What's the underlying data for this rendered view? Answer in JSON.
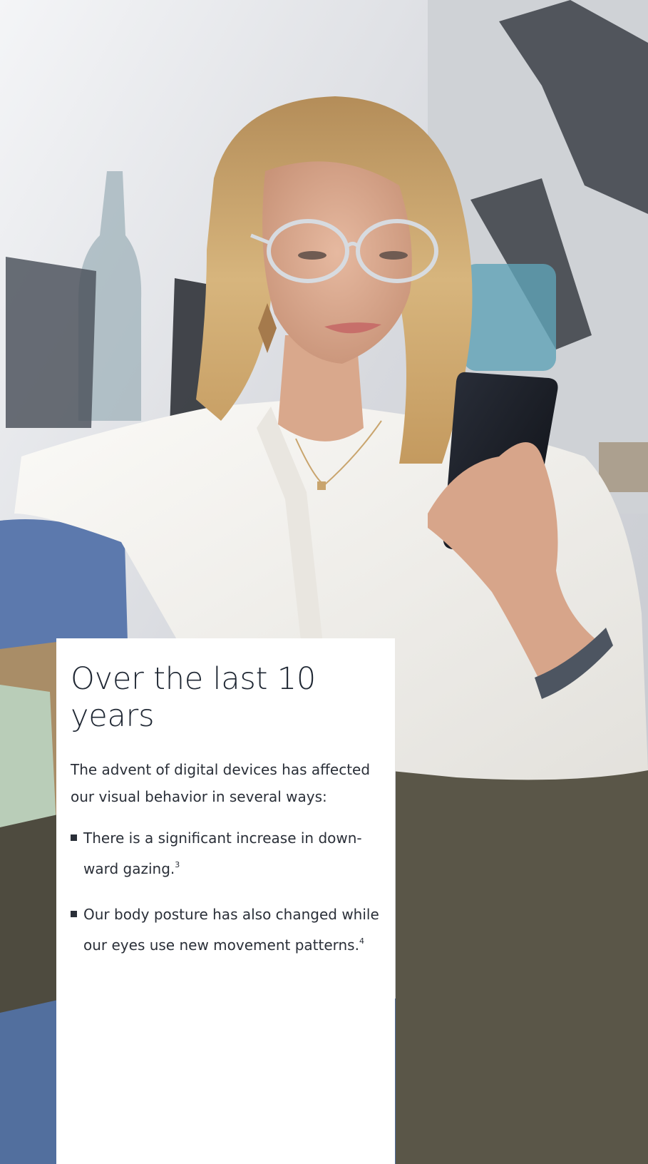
{
  "card": {
    "heading": "Over the last 10 years",
    "intro": "The advent of digital devices has affected our visual behavior in several ways:",
    "bullets": [
      {
        "text": "There is a significant increase in down-ward gazing.",
        "ref": "3"
      },
      {
        "text": "Our body posture has also changed while our eyes use new movement patterns.",
        "ref": "4"
      }
    ]
  },
  "colors": {
    "card_bg": "#ffffff",
    "text": "#2a2f38",
    "heading": "#1f2733",
    "shirt": "#f4f2ee",
    "sofa": "#5c79ad",
    "trousers": "#5a5648",
    "hair": "#c9a56e"
  }
}
